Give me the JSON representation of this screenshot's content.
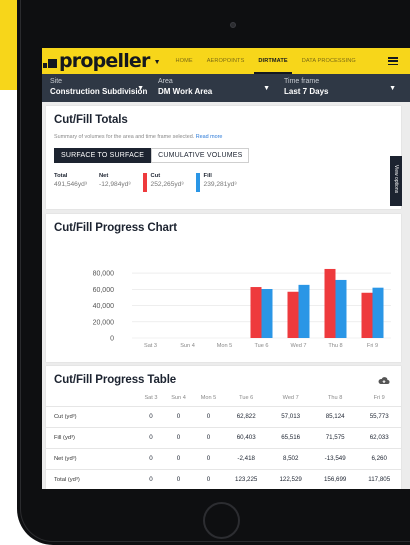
{
  "nav": {
    "logo": "propeller",
    "links": [
      "HOME",
      "AEROPOINTS",
      "DIRTMATE",
      "DATA PROCESSING"
    ],
    "active_index": 2
  },
  "filters": [
    {
      "label": "Site",
      "value": "Construction Subdivision"
    },
    {
      "label": "Area",
      "value": "DM Work Area"
    },
    {
      "label": "Time frame",
      "value": "Last 7 Days"
    }
  ],
  "totals": {
    "title": "Cut/Fill Totals",
    "summary": "Summary of volumes for the area and time frame selected.",
    "read_more": "Read more",
    "toggle": [
      "SURFACE TO SURFACE",
      "CUMULATIVE VOLUMES"
    ],
    "stats": [
      {
        "label": "Total",
        "value": "491,546yd³"
      },
      {
        "label": "Net",
        "value": "-12,984yd³"
      },
      {
        "label": "Cut",
        "value": "252,265yd³",
        "color": "#ee3a3d"
      },
      {
        "label": "Fill",
        "value": "239,281yd³",
        "color": "#2a96e6"
      }
    ],
    "view_options": "View options"
  },
  "chart": {
    "title": "Cut/Fill Progress Chart"
  },
  "chart_data": {
    "type": "bar",
    "categories": [
      "Sat 3",
      "Sun 4",
      "Mon 5",
      "Tue 6",
      "Wed 7",
      "Thu 8",
      "Fri 9"
    ],
    "series": [
      {
        "name": "Cut",
        "color": "#ee3a3d",
        "values": [
          0,
          0,
          0,
          62822,
          57013,
          85124,
          55773
        ]
      },
      {
        "name": "Fill",
        "color": "#2a96e6",
        "values": [
          0,
          0,
          0,
          60403,
          65516,
          71575,
          62033
        ]
      }
    ],
    "yticks": [
      "0",
      "20,000",
      "40,000",
      "60,000",
      "80,000"
    ],
    "ylim": [
      0,
      100000
    ],
    "grid": true
  },
  "table": {
    "title": "Cut/Fill Progress Table",
    "columns": [
      "Sat 3",
      "Sun 4",
      "Mon 5",
      "Tue 6",
      "Wed 7",
      "Thu 8",
      "Fri 9"
    ],
    "rows": [
      {
        "label": "Cut (yd³)",
        "cells": [
          "0",
          "0",
          "0",
          "62,822",
          "57,013",
          "85,124",
          "55,773"
        ]
      },
      {
        "label": "Fill (yd³)",
        "cells": [
          "0",
          "0",
          "0",
          "60,403",
          "65,516",
          "71,575",
          "62,033"
        ]
      },
      {
        "label": "Net (yd³)",
        "cells": [
          "0",
          "0",
          "0",
          "-2,418",
          "8,502",
          "-13,549",
          "6,260"
        ]
      },
      {
        "label": "Total (yd³)",
        "cells": [
          "0",
          "0",
          "0",
          "123,225",
          "122,529",
          "156,699",
          "117,805"
        ]
      }
    ]
  },
  "icons": {
    "menu": "hamburger-icon",
    "download": "cloud-download-icon"
  }
}
